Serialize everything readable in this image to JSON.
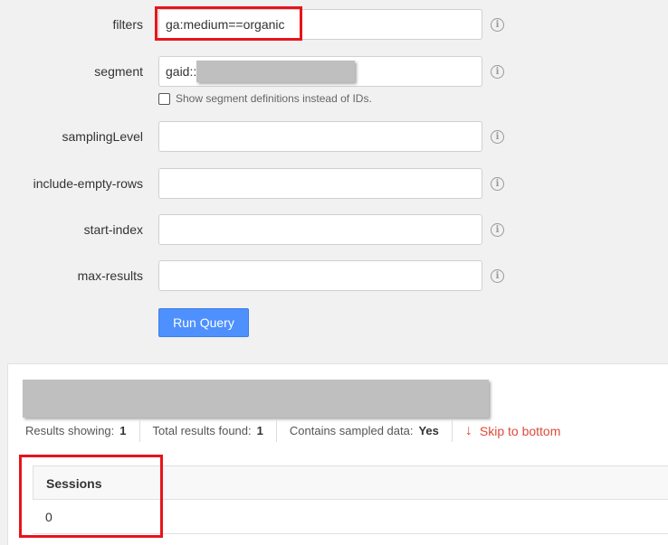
{
  "form": {
    "filters": {
      "label": "filters",
      "value": "ga:medium==organic"
    },
    "segment": {
      "label": "segment",
      "value": "gaid::",
      "checkbox_label": "Show segment definitions instead of IDs."
    },
    "samplingLevel": {
      "label": "samplingLevel",
      "value": ""
    },
    "include_empty_rows": {
      "label": "include-empty-rows",
      "value": ""
    },
    "start_index": {
      "label": "start-index",
      "value": ""
    },
    "max_results": {
      "label": "max-results",
      "value": ""
    },
    "info_glyph": "i",
    "run_button": "Run Query"
  },
  "results": {
    "showing_label": "Results showing:",
    "showing_value": "1",
    "total_label": "Total results found:",
    "total_value": "1",
    "sampled_label": "Contains sampled data:",
    "sampled_value": "Yes",
    "skip_arrow": "↓",
    "skip_label": "Skip to bottom",
    "columns": [
      "Sessions"
    ],
    "rows": [
      [
        "0"
      ]
    ]
  },
  "colors": {
    "highlight": "#e8141b",
    "button": "#4d90fe",
    "link": "#dd4b39"
  }
}
